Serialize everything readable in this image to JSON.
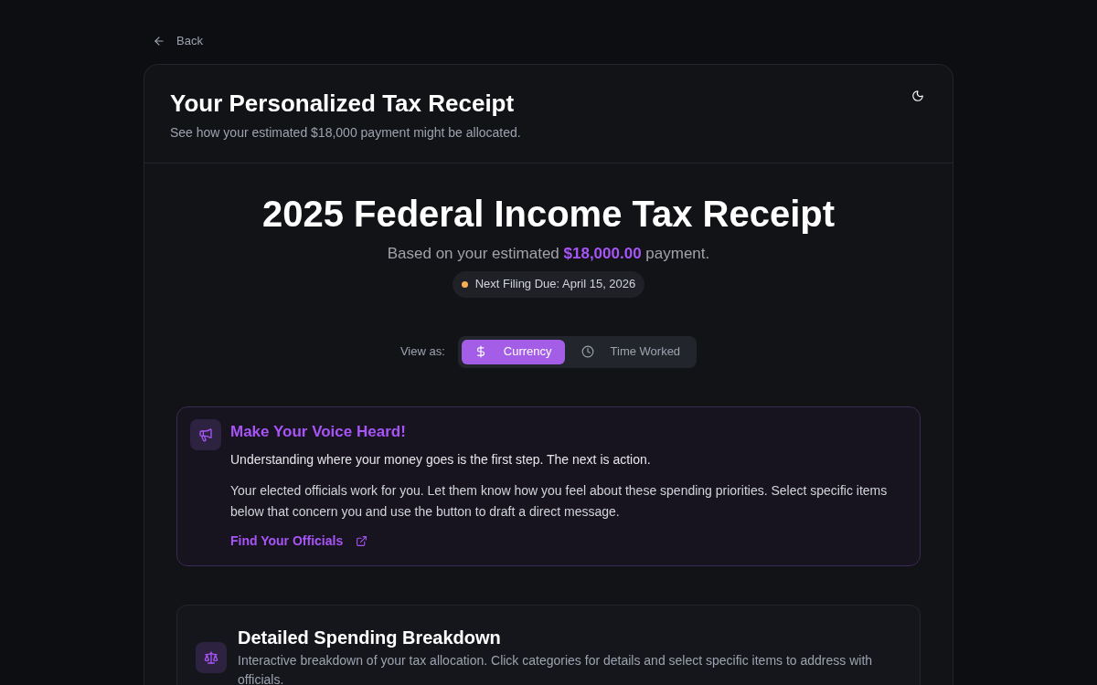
{
  "back": {
    "label": "Back"
  },
  "header": {
    "title": "Your Personalized Tax Receipt",
    "subtitle": "See how your estimated $18,000 payment might be allocated."
  },
  "receipt": {
    "title": "2025 Federal Income Tax Receipt",
    "subtitle": "Based on your estimated **$18,000.00** payment.",
    "due_badge": {
      "label": "Next Filing Due: April 15, 2026",
      "color": "#f6ad55"
    }
  },
  "view_toggle": {
    "label": "View as:",
    "options": [
      {
        "kind": "currency",
        "label": "Currency",
        "selected": true
      },
      {
        "kind": "time",
        "label": "Time Worked",
        "selected": false
      }
    ]
  },
  "voice_card": {
    "title": "Make Your Voice Heard!",
    "lead": "Understanding where your money goes is the first step. The next is action.",
    "body": "Your elected officials work for you. Let them know how you feel about these spending priorities. Select specific items below that concern you and use the button to draft a direct message.",
    "link": "Find Your Officials"
  },
  "breakdown": {
    "title": "Detailed Spending Breakdown",
    "description": "Interactive breakdown of your tax allocation. Click categories for details and select specific items to address with officials."
  }
}
